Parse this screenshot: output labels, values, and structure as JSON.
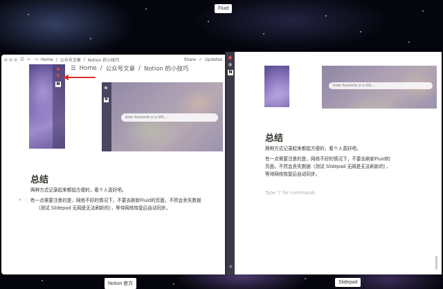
{
  "top_label": "Fluid",
  "bottom_labels": {
    "notion": "Notion 官方",
    "slidepad": "Slidepad"
  },
  "notion": {
    "breadcrumb_small": [
      "Home",
      "公众号文章",
      "Notion 的小技巧"
    ],
    "share": "Share",
    "updates": "Updates",
    "breadcrumb_large": [
      "Home",
      "公众号文章",
      "Notion 的小技巧"
    ],
    "search_placeholder": "Enter Keywords or a URL...",
    "heading": "总结",
    "lines": [
      "两种方式记录起来都挺方便的，看个人喜好吧。",
      "有一点需要注意的是，网络不好的情况下，不要去刷新Fluid的页面，不然会丢失数据",
      "（测试 Slidepad 无网是无法刷新的），等待网络恢复后自动同步。"
    ]
  },
  "slidepad": {
    "search_placeholder": "Enter Keywords or a URL...",
    "heading": "总结",
    "lines": [
      "两种方式记录起来都挺方便的，看个人喜好吧。",
      "有一点需要注意的是，网络不好的情况下，不要去刷新Fluid的",
      "页面，不然会丢失数据（测试 Slidepad 无网是无法刷新的），",
      "等待网络恢复后自动同步。"
    ],
    "command_placeholder": "Type '/' for commands"
  },
  "colors": {
    "arrow": "#e0302b",
    "accent_dot": "#e04848"
  }
}
